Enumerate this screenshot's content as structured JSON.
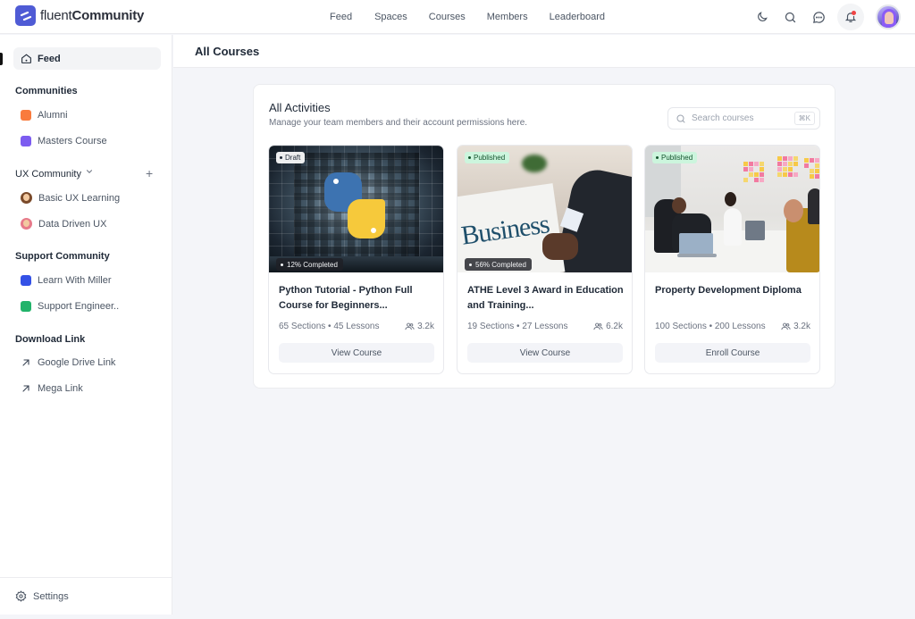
{
  "brand": {
    "name_light": "fluent",
    "name_bold": "Community"
  },
  "nav": [
    "Feed",
    "Spaces",
    "Courses",
    "Members",
    "Leaderboard"
  ],
  "top_icons": [
    "moon-icon",
    "search-icon",
    "chat-icon",
    "bell-icon",
    "user-avatar"
  ],
  "sidebar": {
    "feed_label": "Feed",
    "sections": [
      {
        "title": "Communities",
        "items": [
          {
            "label": "Alumni",
            "color": "#f97b3d"
          },
          {
            "label": "Masters Course",
            "color": "#7c5cf0"
          }
        ]
      },
      {
        "title": "UX Community",
        "items": [
          {
            "label": "Basic UX Learning"
          },
          {
            "label": "Data Driven UX"
          }
        ]
      },
      {
        "title": "Support Community",
        "items": [
          {
            "label": "Learn With Miller",
            "color": "#3451e6"
          },
          {
            "label": "Support Engineer..",
            "color": "#22b36a"
          }
        ]
      },
      {
        "title": "Download Link",
        "items": [
          {
            "label": "Google Drive Link"
          },
          {
            "label": "Mega Link"
          }
        ]
      }
    ],
    "settings_label": "Settings"
  },
  "page": {
    "title": "All Courses"
  },
  "panel": {
    "title": "All Activities",
    "subtitle": "Manage your team members and their account permissions here.",
    "search_placeholder": "Search courses",
    "search_shortcut": "⌘K"
  },
  "courses": [
    {
      "status": "Draft",
      "progress_label": "12% Completed",
      "progress_percent": 12,
      "title": "Python Tutorial - Python Full Course for Beginners...",
      "meta": "65 Sections • 45 Lessons",
      "members": "3.2k",
      "button": "View Course"
    },
    {
      "status": "Published",
      "progress_label": "56% Completed",
      "progress_percent": 56,
      "title": "ATHE Level 3 Award in Education and Training...",
      "meta": "19 Sections • 27 Lessons",
      "members": "6.2k",
      "button": "View Course",
      "thumb_text": "Business"
    },
    {
      "status": "Published",
      "title": "Property Development Diploma",
      "meta": "100 Sections • 200 Lessons",
      "members": "3.2k",
      "button": "Enroll Course"
    }
  ]
}
